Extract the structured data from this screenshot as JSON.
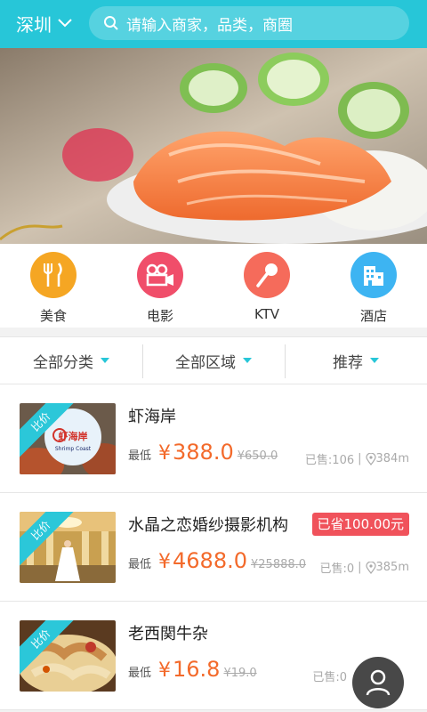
{
  "topbar": {
    "city": "深圳",
    "search_placeholder": "请输入商家，品类，商圈"
  },
  "categories": [
    {
      "label": "美食",
      "icon": "fork-knife-icon",
      "color": "#f5a623"
    },
    {
      "label": "电影",
      "icon": "movie-camera-icon",
      "color": "#f04e6a"
    },
    {
      "label": "KTV",
      "icon": "microphone-icon",
      "color": "#f56b5b"
    },
    {
      "label": "酒店",
      "icon": "hotel-building-icon",
      "color": "#3db4f2"
    }
  ],
  "filters": [
    {
      "label": "全部分类"
    },
    {
      "label": "全部区域"
    },
    {
      "label": "推荐"
    }
  ],
  "deals": [
    {
      "badge": "比价",
      "title": "虾海岸",
      "low_label": "最低",
      "currency": "¥",
      "price": "388.0",
      "original": "¥650.0",
      "sold": "已售:106",
      "distance": "384m",
      "saved": ""
    },
    {
      "badge": "比价",
      "title": "水晶之恋婚纱摄影机构",
      "low_label": "最低",
      "currency": "¥",
      "price": "4688.0",
      "original": "¥25888.0",
      "sold": "已售:0",
      "distance": "385m",
      "saved": "已省100.00元"
    },
    {
      "badge": "比价",
      "title": "老西関牛杂",
      "low_label": "最低",
      "currency": "¥",
      "price": "16.8",
      "original": "¥19.0",
      "sold": "已售:0",
      "distance": "",
      "saved": ""
    }
  ],
  "thumb_logo_text": "Shrimp Coast",
  "colors": {
    "accent": "#27c6d8",
    "price": "#f36a2b",
    "saved_badge": "#f0525b"
  }
}
